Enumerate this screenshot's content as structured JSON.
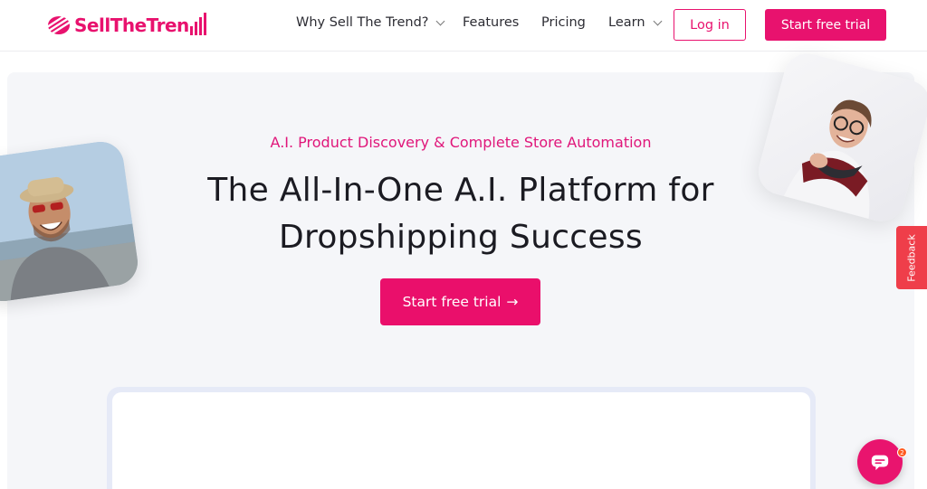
{
  "brand": {
    "name_part1": "Sell",
    "name_part2": "The",
    "name_part3": "Tren",
    "accent_color": "#e8126e"
  },
  "nav": {
    "items": [
      {
        "label": "Why Sell The Trend?",
        "has_dropdown": true
      },
      {
        "label": "Features",
        "has_dropdown": false
      },
      {
        "label": "Pricing",
        "has_dropdown": false
      },
      {
        "label": "Learn",
        "has_dropdown": true
      }
    ],
    "login_label": "Log in",
    "trial_label": "Start free trial"
  },
  "hero": {
    "tagline": "A.I. Product Discovery & Complete Store Automation",
    "headline_line1": "The All-In-One A.I. Platform for",
    "headline_line2": "Dropshipping Success",
    "cta_label": "Start free trial",
    "cta_arrow": "→"
  },
  "feedback": {
    "label": "Feedback"
  },
  "chat": {
    "badge_count": "2"
  },
  "icons": [
    "logo-mark-icon",
    "chevron-down-icon",
    "arrow-right-icon",
    "chat-icon"
  ]
}
